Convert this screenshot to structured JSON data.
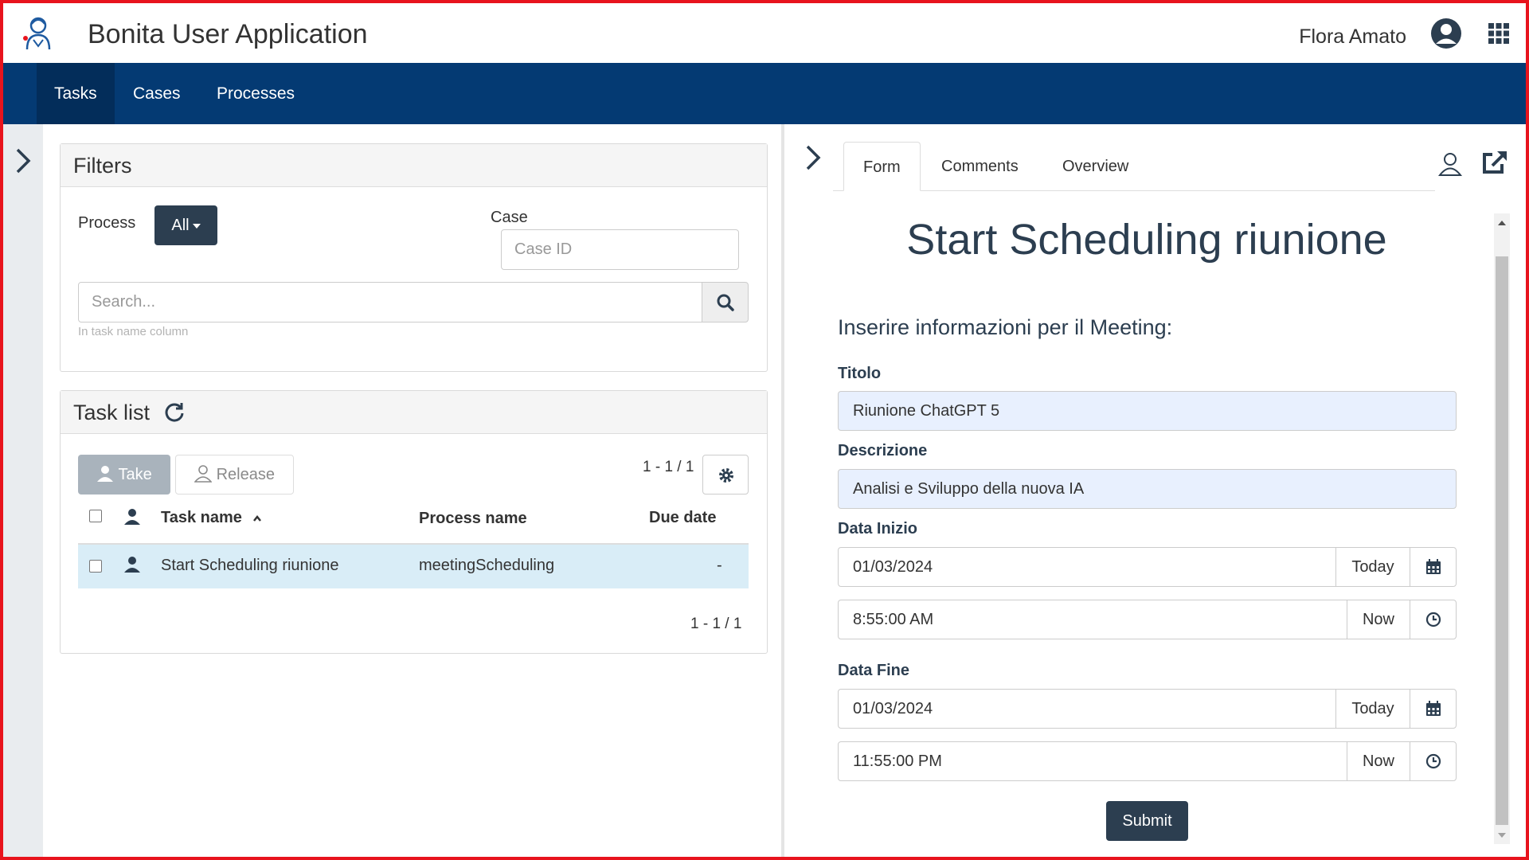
{
  "app": {
    "title": "Bonita User Application",
    "user_name": "Flora Amato"
  },
  "nav": {
    "tasks": "Tasks",
    "cases": "Cases",
    "processes": "Processes"
  },
  "filters": {
    "title": "Filters",
    "process_label": "Process",
    "process_value": "All",
    "case_label": "Case",
    "case_placeholder": "Case ID",
    "search_placeholder": "Search...",
    "search_help": "In task name column"
  },
  "task_list": {
    "title": "Task list",
    "take_label": "Take",
    "release_label": "Release",
    "pagination_top": "1 - 1 / 1",
    "pagination_bottom": "1 - 1 / 1",
    "columns": {
      "task_name": "Task name",
      "process_name": "Process name",
      "due_date": "Due date"
    },
    "rows": [
      {
        "task_name": "Start Scheduling riunione",
        "process_name": "meetingScheduling",
        "due_date": "-"
      }
    ]
  },
  "details": {
    "tabs": {
      "form": "Form",
      "comments": "Comments",
      "overview": "Overview"
    },
    "form_title": "Start Scheduling riunione",
    "form_subtitle": "Inserire informazioni per il Meeting:",
    "fields": {
      "titolo_label": "Titolo",
      "titolo_value": "Riunione ChatGPT 5",
      "descrizione_label": "Descrizione",
      "descrizione_value": "Analisi e Sviluppo della nuova IA",
      "data_inizio_label": "Data Inizio",
      "data_inizio_date": "01/03/2024",
      "data_inizio_time": "8:55:00 AM",
      "data_fine_label": "Data Fine",
      "data_fine_date": "01/03/2024",
      "data_fine_time": "11:55:00 PM",
      "today_label": "Today",
      "now_label": "Now"
    },
    "submit_label": "Submit"
  },
  "colors": {
    "navbar": "#043a73",
    "navbar_active": "#032d5a",
    "dark_button": "#2c3e50",
    "selected_row": "#d9edf7",
    "autofill": "#e8f0fe",
    "frame": "#e8141d"
  }
}
